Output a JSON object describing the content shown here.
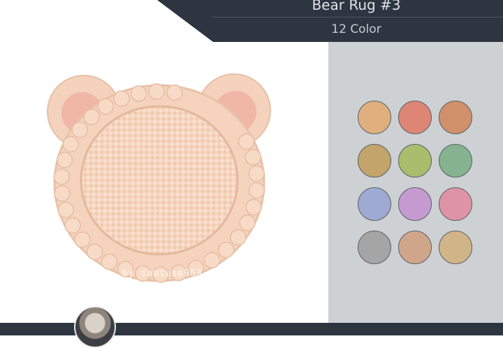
{
  "header": {
    "title": "Bear Rug #3",
    "subtitle": "12 Color"
  },
  "product": {
    "watermark": "by samtuse963"
  },
  "palette": {
    "swatches": [
      {
        "color": "#dfb07e"
      },
      {
        "color": "#dd8676"
      },
      {
        "color": "#cf906a"
      },
      {
        "color": "#c3a46a"
      },
      {
        "color": "#a9bd6c"
      },
      {
        "color": "#85b38f"
      },
      {
        "color": "#9eaad2"
      },
      {
        "color": "#c49ad0"
      },
      {
        "color": "#de94a6"
      },
      {
        "color": "#a5a5a5"
      },
      {
        "color": "#cfa68a"
      },
      {
        "color": "#d1b488"
      }
    ]
  },
  "icons": {
    "avatar": "author-avatar-icon"
  }
}
